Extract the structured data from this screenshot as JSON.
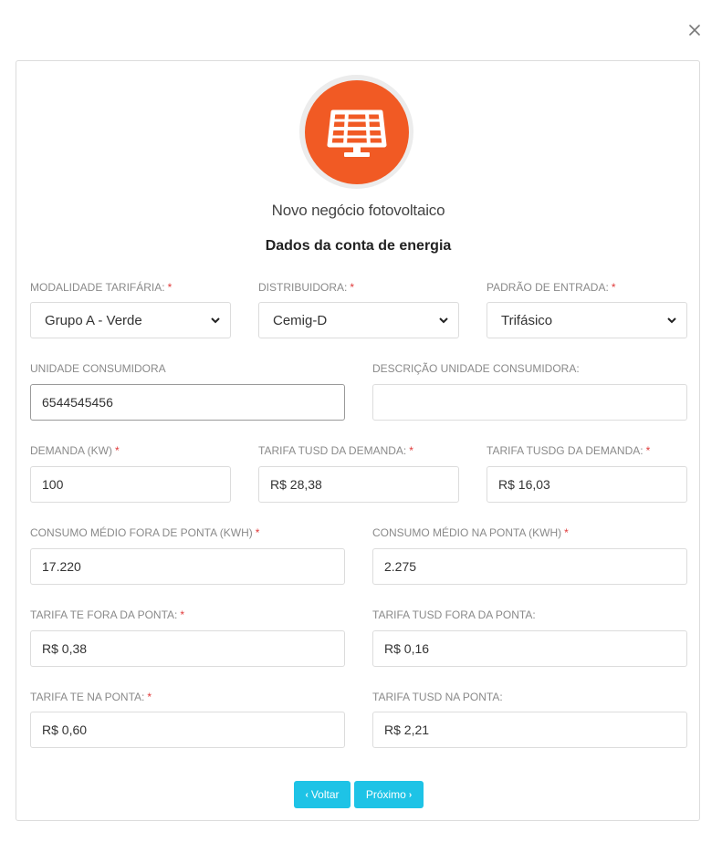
{
  "modal": {
    "subtitle": "Novo negócio fotovoltaico",
    "section_title": "Dados da conta de energia"
  },
  "icons": {
    "close": "close-icon",
    "logo": "solar-panel-icon",
    "accent_color": "#f15a24",
    "button_color": "#1ec3e6"
  },
  "fields": {
    "modalidade": {
      "label": "MODALIDADE TARIFÁRIA:",
      "required": "*",
      "value": "Grupo A - Verde"
    },
    "distribuidora": {
      "label": "DISTRIBUIDORA:",
      "required": "*",
      "value": "Cemig-D"
    },
    "padrao": {
      "label": "PADRÃO DE ENTRADA:",
      "required": "*",
      "value": "Trifásico"
    },
    "unidade": {
      "label": "UNIDADE CONSUMIDORA",
      "value": "6544545456"
    },
    "descricao": {
      "label": "DESCRIÇÃO UNIDADE CONSUMIDORA:",
      "value": ""
    },
    "demanda": {
      "label": "DEMANDA (KW)",
      "required": "*",
      "value": "100"
    },
    "tusd_demanda": {
      "label": "TARIFA TUSD DA DEMANDA:",
      "required": "*",
      "value": "R$ 28,38"
    },
    "tusdg_demanda": {
      "label": "TARIFA TUSDG DA DEMANDA:",
      "required": "*",
      "value": "R$ 16,03"
    },
    "consumo_fora": {
      "label": "CONSUMO MÉDIO FORA DE PONTA (KWH)",
      "required": "*",
      "value": "17.220"
    },
    "consumo_ponta": {
      "label": "CONSUMO MÉDIO NA PONTA (KWH)",
      "required": "*",
      "value": "2.275"
    },
    "te_fora": {
      "label": "TARIFA TE FORA DA PONTA:",
      "required": "*",
      "value": "R$ 0,38"
    },
    "tusd_fora": {
      "label": "TARIFA TUSD FORA DA PONTA:",
      "value": "R$ 0,16"
    },
    "te_ponta": {
      "label": "TARIFA TE NA PONTA:",
      "required": "*",
      "value": "R$ 0,60"
    },
    "tusd_ponta": {
      "label": "TARIFA TUSD NA PONTA:",
      "value": "R$ 2,21"
    }
  },
  "buttons": {
    "back": {
      "label": "Voltar",
      "arrow": "‹"
    },
    "next": {
      "label": "Próximo",
      "arrow": "›"
    }
  }
}
